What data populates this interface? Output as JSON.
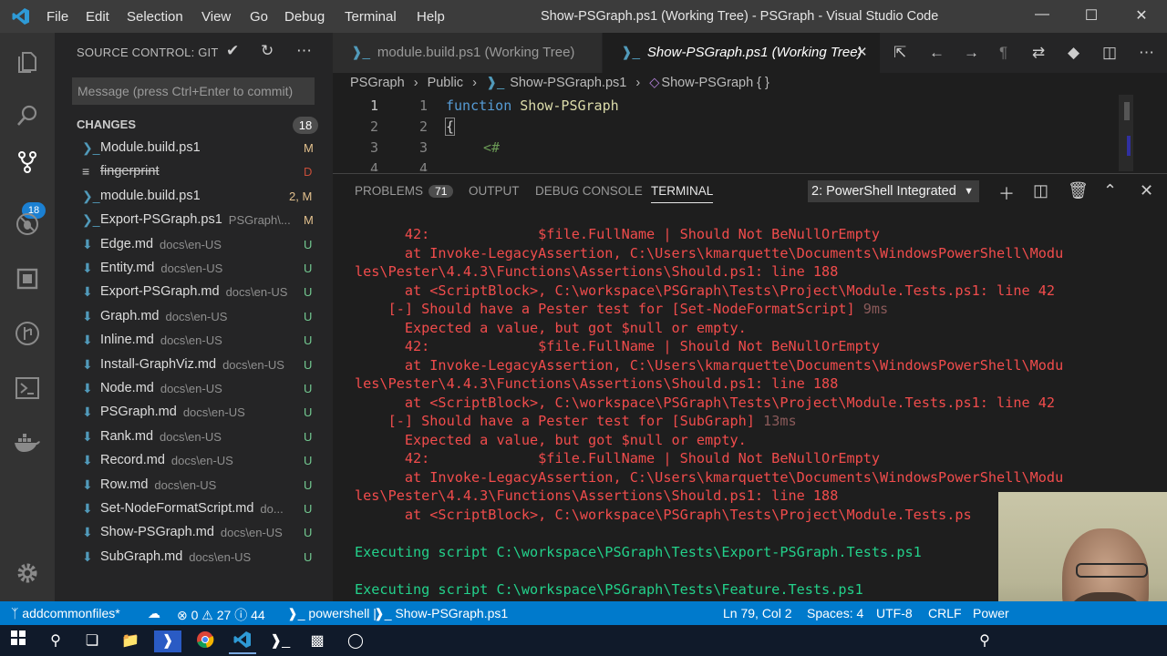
{
  "window": {
    "title": "Show-PSGraph.ps1 (Working Tree) - PSGraph - Visual Studio Code",
    "menu": [
      "File",
      "Edit",
      "Selection",
      "View",
      "Go",
      "Debug",
      "Terminal",
      "Help"
    ]
  },
  "activity": {
    "items": [
      "explorer-icon",
      "search-icon",
      "source-control-icon",
      "debug-icon",
      "extensions-icon",
      "git-history-icon",
      "remote-icon",
      "docker-icon",
      "settings-icon"
    ],
    "scm_badge": "18"
  },
  "sidebar": {
    "title": "SOURCE CONTROL: GIT",
    "commit_placeholder": "Message (press Ctrl+Enter to commit)",
    "changes_label": "CHANGES",
    "changes_count": "18",
    "files": [
      {
        "name": "Module.build.ps1",
        "dir": "",
        "status": "M",
        "type": "ps"
      },
      {
        "name": "fingerprint",
        "dir": "",
        "status": "D",
        "type": "text"
      },
      {
        "name": "module.build.ps1",
        "dir": "",
        "status": "2, M",
        "type": "ps"
      },
      {
        "name": "Export-PSGraph.ps1",
        "dir": "PSGraph\\...",
        "status": "M",
        "type": "ps"
      },
      {
        "name": "Edge.md",
        "dir": "docs\\en-US",
        "status": "U",
        "type": "md"
      },
      {
        "name": "Entity.md",
        "dir": "docs\\en-US",
        "status": "U",
        "type": "md"
      },
      {
        "name": "Export-PSGraph.md",
        "dir": "docs\\en-US",
        "status": "U",
        "type": "md"
      },
      {
        "name": "Graph.md",
        "dir": "docs\\en-US",
        "status": "U",
        "type": "md"
      },
      {
        "name": "Inline.md",
        "dir": "docs\\en-US",
        "status": "U",
        "type": "md"
      },
      {
        "name": "Install-GraphViz.md",
        "dir": "docs\\en-US",
        "status": "U",
        "type": "md"
      },
      {
        "name": "Node.md",
        "dir": "docs\\en-US",
        "status": "U",
        "type": "md"
      },
      {
        "name": "PSGraph.md",
        "dir": "docs\\en-US",
        "status": "U",
        "type": "md"
      },
      {
        "name": "Rank.md",
        "dir": "docs\\en-US",
        "status": "U",
        "type": "md"
      },
      {
        "name": "Record.md",
        "dir": "docs\\en-US",
        "status": "U",
        "type": "md"
      },
      {
        "name": "Row.md",
        "dir": "docs\\en-US",
        "status": "U",
        "type": "md"
      },
      {
        "name": "Set-NodeFormatScript.md",
        "dir": "do...",
        "status": "U",
        "type": "md"
      },
      {
        "name": "Show-PSGraph.md",
        "dir": "docs\\en-US",
        "status": "U",
        "type": "md"
      },
      {
        "name": "SubGraph.md",
        "dir": "docs\\en-US",
        "status": "U",
        "type": "md"
      }
    ]
  },
  "tabs": [
    {
      "label": "module.build.ps1 (Working Tree)"
    },
    {
      "label": "Show-PSGraph.ps1 (Working Tree)"
    }
  ],
  "breadcrumb": [
    "PSGraph",
    "Public",
    "Show-PSGraph.ps1",
    "Show-PSGraph { }"
  ],
  "editor": {
    "lines": [
      {
        "left": "1",
        "right": "1",
        "keyword": "function",
        "name": "Show-PSGraph"
      },
      {
        "left": "2",
        "right": "2",
        "text": "{"
      },
      {
        "left": "3",
        "right": "3",
        "text": "<#"
      },
      {
        "left": "4",
        "right": "4",
        "text": ""
      }
    ]
  },
  "panel": {
    "tabs": [
      {
        "label": "PROBLEMS",
        "badge": "71"
      },
      {
        "label": "OUTPUT"
      },
      {
        "label": "DEBUG CONSOLE"
      },
      {
        "label": "TERMINAL"
      }
    ],
    "terminal_select": "2: PowerShell Integrated",
    "terminal_lines": [
      {
        "text": "      42:             $file.FullName | Should Not BeNullOrEmpty",
        "kind": "error"
      },
      {
        "text": "      at Invoke-LegacyAssertion, C:\\Users\\kmarquette\\Documents\\WindowsPowerShell\\Modu",
        "kind": "error"
      },
      {
        "text": "les\\Pester\\4.4.3\\Functions\\Assertions\\Should.ps1: line 188",
        "kind": "error"
      },
      {
        "text": "      at <ScriptBlock>, C:\\workspace\\PSGraph\\Tests\\Project\\Module.Tests.ps1: line 42",
        "kind": "error"
      },
      {
        "text": "    [-] Should have a Pester test for [Set-NodeFormatScript]",
        "time": " 9ms",
        "kind": "error"
      },
      {
        "text": "      Expected a value, but got $null or empty.",
        "kind": "error"
      },
      {
        "text": "      42:             $file.FullName | Should Not BeNullOrEmpty",
        "kind": "error"
      },
      {
        "text": "      at Invoke-LegacyAssertion, C:\\Users\\kmarquette\\Documents\\WindowsPowerShell\\Modu",
        "kind": "error"
      },
      {
        "text": "les\\Pester\\4.4.3\\Functions\\Assertions\\Should.ps1: line 188",
        "kind": "error"
      },
      {
        "text": "      at <ScriptBlock>, C:\\workspace\\PSGraph\\Tests\\Project\\Module.Tests.ps1: line 42",
        "kind": "error"
      },
      {
        "text": "    [-] Should have a Pester test for [SubGraph]",
        "time": " 13ms",
        "kind": "error"
      },
      {
        "text": "      Expected a value, but got $null or empty.",
        "kind": "error"
      },
      {
        "text": "      42:             $file.FullName | Should Not BeNullOrEmpty",
        "kind": "error"
      },
      {
        "text": "      at Invoke-LegacyAssertion, C:\\Users\\kmarquette\\Documents\\WindowsPowerShell\\Modu",
        "kind": "error"
      },
      {
        "text": "les\\Pester\\4.4.3\\Functions\\Assertions\\Should.ps1: line 188",
        "kind": "error"
      },
      {
        "text": "      at <ScriptBlock>, C:\\workspace\\PSGraph\\Tests\\Project\\Module.Tests.ps",
        "kind": "error"
      },
      {
        "text": "",
        "kind": "blank"
      },
      {
        "text": "Executing script C:\\workspace\\PSGraph\\Tests\\Export-PSGraph.Tests.ps1",
        "kind": "info"
      },
      {
        "text": "",
        "kind": "blank"
      },
      {
        "text": "Executing script C:\\workspace\\PSGraph\\Tests\\Feature.Tests.ps1",
        "kind": "info"
      }
    ]
  },
  "status": {
    "branch": "addcommonfiles*",
    "errors": "0",
    "warnings": "27",
    "info": "44",
    "language_mode": "powershell",
    "file": "Show-PSGraph.ps1",
    "position": "Ln 79, Col 2",
    "spaces": "Spaces: 4",
    "encoding": "UTF-8",
    "eol": "CRLF",
    "language": "Power"
  },
  "colors": {
    "accent": "#007acc",
    "error_text": "#f14c4c",
    "info_text": "#23d18b",
    "untracked": "#73c991",
    "modified": "#e2c08d",
    "deleted": "#c74e39"
  }
}
